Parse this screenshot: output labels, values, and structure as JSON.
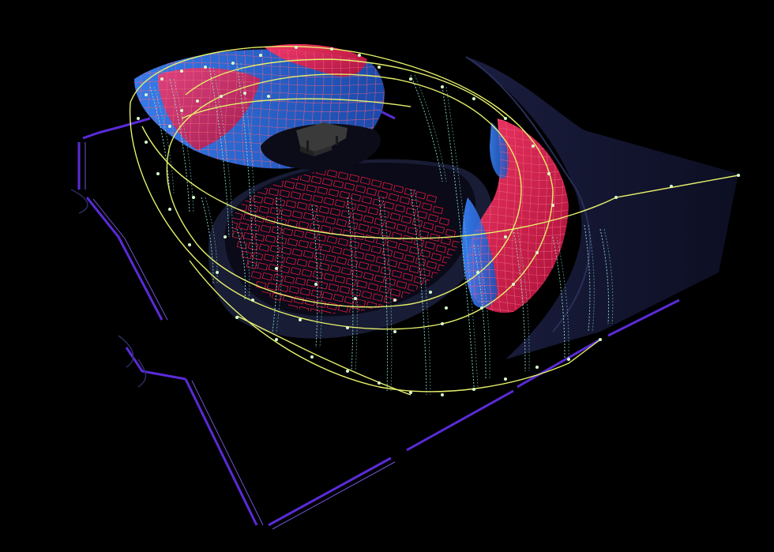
{
  "scene": {
    "background_color": "#000000",
    "floor_outline_color": "#5a2bd8",
    "floor_inner_line_color": "#8b6cff",
    "backdrop_panel_color": "#141633",
    "seating_floor_color": "#0a0a18",
    "seating_ring_color": "#1b1f3a",
    "seat_grid_color": "#e0193f",
    "shell_red_color": "#e01a4f",
    "shell_blue_color": "#2f6fe0",
    "shell_mesh_color": "#f06080",
    "curve_color": "#e6f06a",
    "rib_color": "#8ff0e0",
    "control_point_color": "#d7ffd0",
    "piano_color": "#3a3a3a"
  }
}
